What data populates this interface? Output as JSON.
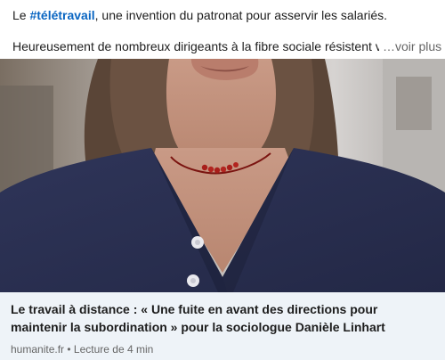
{
  "post": {
    "line1_prefix": "Le ",
    "hashtag": "#télétravail",
    "line1_suffix": ", une invention du patronat pour asservir les salariés.",
    "line2": "Heureusement de nombreux dirigeants à la fibre sociale résistent vaillamm",
    "see_more": "…voir plus"
  },
  "card": {
    "image_icon": "photo-woman-portrait",
    "headline": "Le travail à distance : « Une fuite en avant des directions pour maintenir la subordination » pour la sociologue Danièle Linhart",
    "source": "humanite.fr",
    "separator": " • ",
    "read_time": "Lecture de 4 min"
  }
}
